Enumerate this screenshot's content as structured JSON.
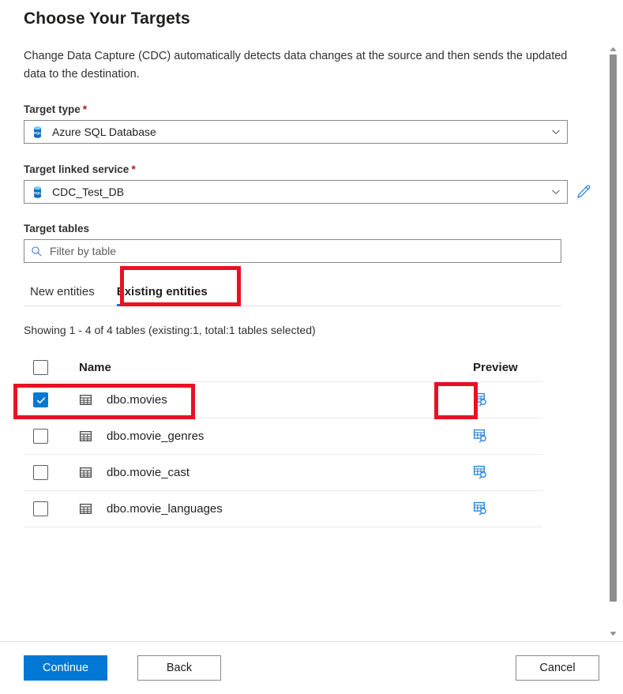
{
  "page": {
    "title": "Choose Your Targets",
    "description": "Change Data Capture (CDC) automatically detects data changes at the source and then sends the updated data to the destination."
  },
  "fields": {
    "target_type": {
      "label": "Target type",
      "required_mark": "*",
      "value": "Azure SQL Database",
      "icon": "azure-sql-database-icon",
      "chevron": "chevron-down-icon"
    },
    "target_linked_service": {
      "label": "Target linked service",
      "required_mark": "*",
      "value": "CDC_Test_DB",
      "icon": "azure-sql-database-icon",
      "chevron": "chevron-down-icon",
      "edit_icon": "pencil-icon"
    },
    "target_tables": {
      "label": "Target tables",
      "search_placeholder": "Filter by table",
      "search_value": "",
      "search_icon": "search-icon"
    }
  },
  "tabs": [
    {
      "label": "New entities",
      "active": false
    },
    {
      "label": "Existing entities",
      "active": true
    }
  ],
  "table": {
    "showing_text": "Showing 1 - 4 of 4 tables (existing:1, total:1 tables selected)",
    "columns": {
      "select_all": "",
      "name": "Name",
      "preview": "Preview"
    },
    "header_checkbox_checked": false,
    "rows": [
      {
        "name": "dbo.movies",
        "checked": true,
        "table_icon": "table-grid-icon",
        "preview_icon": "preview-table-icon"
      },
      {
        "name": "dbo.movie_genres",
        "checked": false,
        "table_icon": "table-grid-icon",
        "preview_icon": "preview-table-icon"
      },
      {
        "name": "dbo.movie_cast",
        "checked": false,
        "table_icon": "table-grid-icon",
        "preview_icon": "preview-table-icon"
      },
      {
        "name": "dbo.movie_languages",
        "checked": false,
        "table_icon": "table-grid-icon",
        "preview_icon": "preview-table-icon"
      }
    ]
  },
  "footer": {
    "continue_label": "Continue",
    "back_label": "Back",
    "cancel_label": "Cancel"
  },
  "scrollbar": {
    "up_icon": "scroll-up-arrow-icon",
    "down_icon": "scroll-down-arrow-icon"
  },
  "colors": {
    "accent": "#0078d4",
    "annotation": "#e81123",
    "required": "#a4262c"
  },
  "annotations": [
    {
      "name": "highlight-existing-entities-tab"
    },
    {
      "name": "highlight-selected-row"
    },
    {
      "name": "highlight-preview-icon"
    }
  ]
}
